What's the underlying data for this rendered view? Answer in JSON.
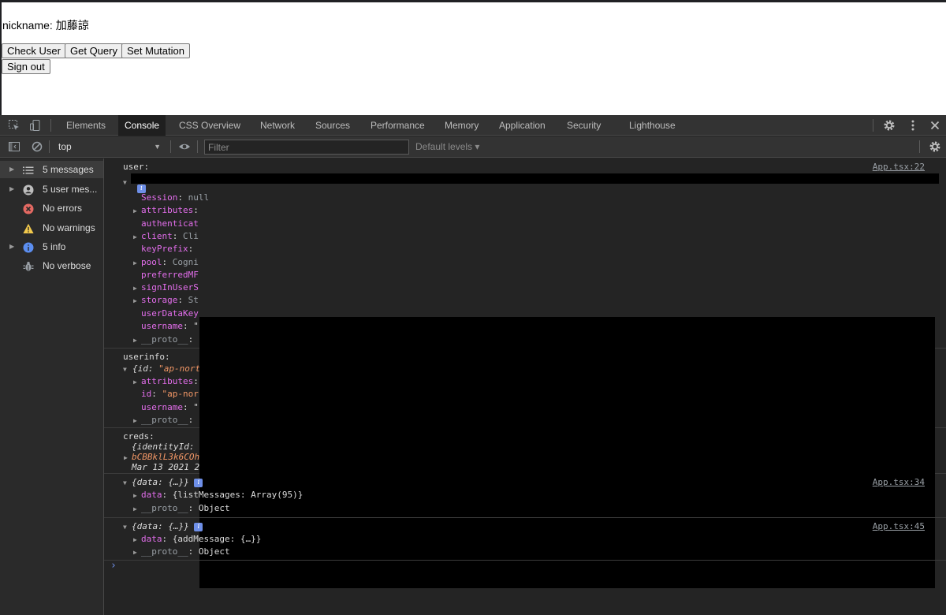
{
  "page": {
    "nickname_text": "nickname: 加藤諒",
    "buttons": {
      "check_user": "Check User",
      "get_query": "Get Query",
      "set_mutation": "Set Mutation",
      "sign_out": "Sign out"
    }
  },
  "devtools": {
    "tabs": [
      "Elements",
      "Console",
      "CSS Overview",
      "Network",
      "Sources",
      "Performance",
      "Memory",
      "Application",
      "Security",
      "Lighthouse"
    ],
    "active_tab": "Console",
    "icons": {
      "inspect": "inspect-element-icon",
      "device": "device-toolbar-icon",
      "settings": "gear-icon",
      "more": "kebab-menu-icon",
      "close": "close-icon",
      "sidebar_toggle": "sidebar-toggle-icon",
      "clear": "clear-console-icon",
      "live_expression": "eye-icon"
    },
    "toolbar": {
      "context": "top",
      "filter_placeholder": "Filter",
      "levels": "Default levels ▾"
    },
    "sidebar": [
      {
        "label": "5 messages",
        "icon": "list-icon",
        "expandable": true,
        "selected": true
      },
      {
        "label": "5 user mes...",
        "icon": "user-icon",
        "expandable": true,
        "selected": false
      },
      {
        "label": "No errors",
        "icon": "error-icon",
        "expandable": false,
        "selected": false
      },
      {
        "label": "No warnings",
        "icon": "warning-icon",
        "expandable": false,
        "selected": false
      },
      {
        "label": "5 info",
        "icon": "info-icon",
        "expandable": true,
        "selected": false
      },
      {
        "label": "No verbose",
        "icon": "bug-icon",
        "expandable": false,
        "selected": false
      }
    ],
    "console": {
      "msg1": {
        "label": "user:",
        "source": "App.tsx:22",
        "props": [
          {
            "key": "Session",
            "value": "null",
            "expandable": false
          },
          {
            "key": "attributes",
            "value": "",
            "expandable": true
          },
          {
            "key": "authenticat",
            "value": "",
            "expandable": false
          },
          {
            "key": "client",
            "value": "Cli",
            "expandable": true
          },
          {
            "key": "keyPrefix",
            "value": "",
            "expandable": false
          },
          {
            "key": "pool",
            "value": "Cogni",
            "expandable": true
          },
          {
            "key": "preferredMF",
            "value": "",
            "expandable": false
          },
          {
            "key": "signInUserS",
            "value": "",
            "expandable": true
          },
          {
            "key": "storage",
            "value": "St",
            "expandable": true
          },
          {
            "key": "userDataKey",
            "value": "",
            "expandable": false
          },
          {
            "key": "username",
            "value": "\"",
            "expandable": false
          },
          {
            "key": "__proto__",
            "value": "",
            "expandable": true
          }
        ]
      },
      "msg2": {
        "label": "userinfo:",
        "summary_prefix": "{id: ",
        "summary_value": "\"ap-nort",
        "props": [
          {
            "key": "attributes",
            "value": "",
            "expandable": true
          },
          {
            "key": "id",
            "value": "\"ap-nor",
            "expandable": false
          },
          {
            "key": "username",
            "value": "\"",
            "expandable": false
          },
          {
            "key": "__proto__",
            "value": "",
            "expandable": true
          }
        ]
      },
      "msg3": {
        "label": "creds:",
        "line1": "{identityId:",
        "line2": "bCBBklL3k6COh",
        "line3": "Mar 13 2021 2"
      },
      "msg4": {
        "summary": "{data: {…}}",
        "source": "App.tsx:34",
        "data_line": "{listMessages: Array(95)}",
        "proto_value": "Object"
      },
      "msg5": {
        "summary": "{data: {…}}",
        "source": "App.tsx:45",
        "data_line": "{addMessage: {…}}",
        "proto_value": "Object"
      },
      "info_badge": "i",
      "prompt": "›"
    }
  }
}
